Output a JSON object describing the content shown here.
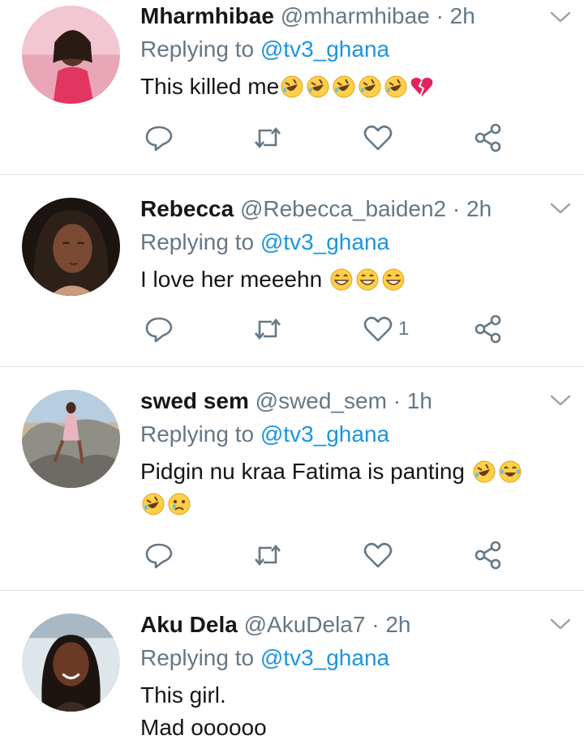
{
  "colors": {
    "secondary_text": "#657786",
    "link": "#1b95e0",
    "divider": "#dfe3e6"
  },
  "tweets": [
    {
      "name": "Mharmhibae",
      "handle": "@mharmhibae",
      "sep": "·",
      "time": "2h",
      "replying_prefix": "Replying to ",
      "replying_to": "@tv3_ghana",
      "text_lines": [
        "This killed me"
      ],
      "emojis": [
        "rofl",
        "rofl",
        "rofl",
        "rofl",
        "rofl",
        "broken-heart"
      ],
      "like_count": ""
    },
    {
      "name": "Rebecca",
      "handle": "@Rebecca_baiden2",
      "sep": "·",
      "time": "2h",
      "replying_prefix": "Replying to ",
      "replying_to": "@tv3_ghana",
      "text_lines": [
        "I love her meeehn "
      ],
      "emojis": [
        "grin",
        "grin",
        "grin"
      ],
      "like_count": "1"
    },
    {
      "name": "swed sem",
      "handle": "@swed_sem",
      "sep": "·",
      "time": "1h",
      "replying_prefix": "Replying to ",
      "replying_to": "@tv3_ghana",
      "text_lines": [
        "Pidgin nu kraa Fatima is panting "
      ],
      "emojis": [
        "rofl",
        "joy",
        "rofl",
        "sad-tear"
      ],
      "like_count": ""
    },
    {
      "name": "Aku Dela",
      "handle": "@AkuDela7",
      "sep": "·",
      "time": "2h",
      "replying_prefix": "Replying to ",
      "replying_to": "@tv3_ghana",
      "text_lines": [
        "This girl.",
        "Mad oooooo"
      ],
      "emojis": [],
      "like_count": ""
    }
  ]
}
